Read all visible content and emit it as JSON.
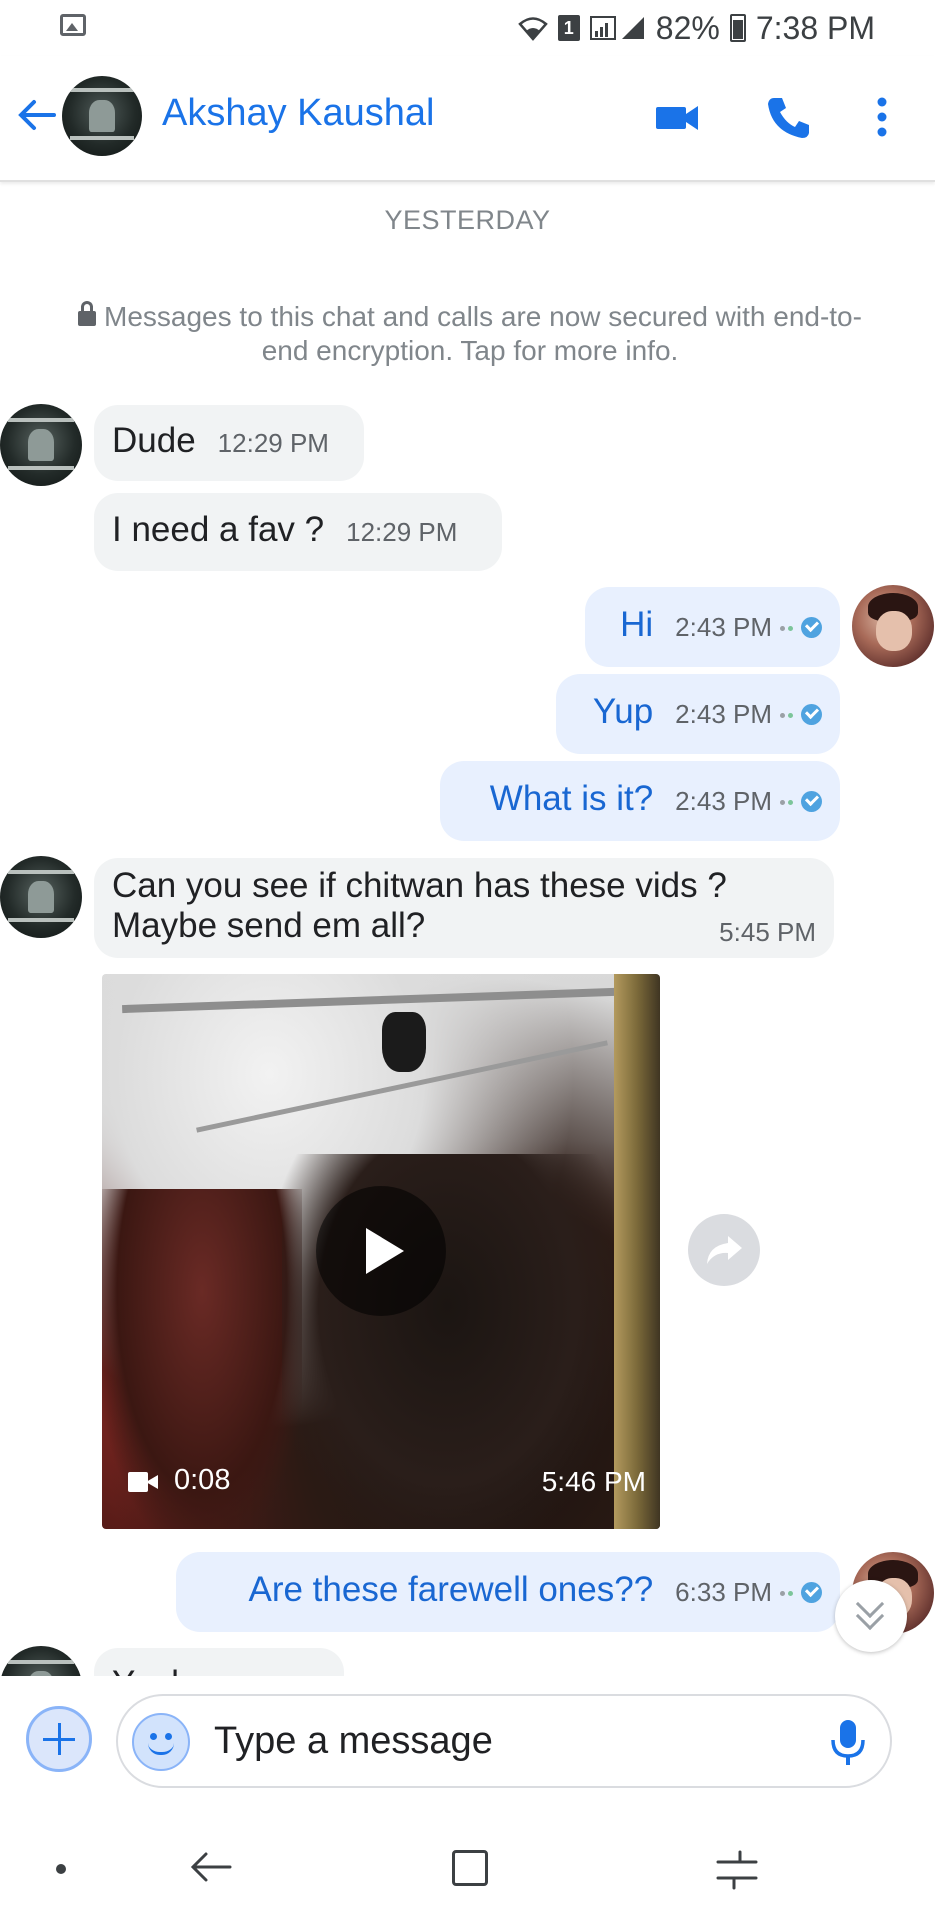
{
  "status_bar": {
    "sim_slot": "1",
    "battery": "82%",
    "time": "7:38 PM"
  },
  "header": {
    "contact_name": "Akshay Kaushal",
    "icons": [
      "back-arrow-icon",
      "video-call-icon",
      "phone-call-icon",
      "more-vert-icon"
    ]
  },
  "conversation": {
    "date_label": "YESTERDAY",
    "encryption_notice": "Messages to this chat and calls are now secured with end-to-end encryption. Tap for more info.",
    "messages": [
      {
        "from": "them",
        "text": "Dude",
        "time": "12:29 PM"
      },
      {
        "from": "them",
        "text": "I need a fav ?",
        "time": "12:29 PM"
      },
      {
        "from": "me",
        "text": "Hi",
        "time": "2:43 PM"
      },
      {
        "from": "me",
        "text": "Yup",
        "time": "2:43 PM"
      },
      {
        "from": "me",
        "text": "What is it?",
        "time": "2:43 PM"
      },
      {
        "from": "them",
        "text_line1": "Can you see if chitwan has these vids ?",
        "text_line2": "Maybe send em all?",
        "time": "5:45 PM"
      },
      {
        "from": "them",
        "type": "video",
        "duration": "0:08",
        "time": "5:46 PM"
      },
      {
        "from": "me",
        "text": "Are these farewell ones??",
        "time": "6:33 PM"
      },
      {
        "from": "them",
        "text": "Yeah"
      }
    ]
  },
  "composer": {
    "placeholder": "Type a message"
  },
  "colors": {
    "accent": "#1a73e8",
    "outgoing_bubble": "#e8f0fe",
    "incoming_bubble": "#f1f3f4"
  }
}
